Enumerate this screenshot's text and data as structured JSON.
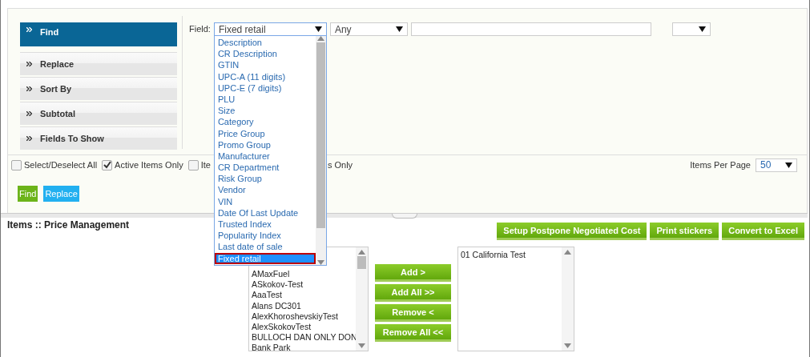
{
  "menu": [
    {
      "label": "Find",
      "selected": true
    },
    {
      "label": "Replace",
      "selected": false
    },
    {
      "label": "Sort By",
      "selected": false
    },
    {
      "label": "Subtotal",
      "selected": false
    },
    {
      "label": "Fields To Show",
      "selected": false
    }
  ],
  "filter": {
    "label": "Field:",
    "field_value": "Fixed retail",
    "operator_value": "Any",
    "field_options": [
      {
        "label": "Description",
        "selected": false
      },
      {
        "label": "CR Description",
        "selected": false
      },
      {
        "label": "GTIN",
        "selected": false
      },
      {
        "label": "UPC-A (11 digits)",
        "selected": false
      },
      {
        "label": "UPC-E (7 digits)",
        "selected": false
      },
      {
        "label": "PLU",
        "selected": false
      },
      {
        "label": "Size",
        "selected": false
      },
      {
        "label": "Category",
        "selected": false
      },
      {
        "label": "Price Group",
        "selected": false
      },
      {
        "label": "Promo Group",
        "selected": false
      },
      {
        "label": "Manufacturer",
        "selected": false
      },
      {
        "label": "CR Department",
        "selected": false
      },
      {
        "label": "Risk Group",
        "selected": false
      },
      {
        "label": "Vendor",
        "selected": false
      },
      {
        "label": "VIN",
        "selected": false
      },
      {
        "label": "Date Of Last Update",
        "selected": false
      },
      {
        "label": "Trusted Index",
        "selected": false
      },
      {
        "label": "Popularity Index",
        "selected": false
      },
      {
        "label": "Last date of sale",
        "selected": false
      },
      {
        "label": "Fixed retail",
        "selected": true
      }
    ]
  },
  "options": [
    {
      "label": "Select/Deselect All",
      "checked": false
    },
    {
      "label": "Active Items Only",
      "checked": true
    },
    {
      "label": "Ite",
      "checked": false
    }
  ],
  "options_tail": "s Only",
  "items_per_page": {
    "label": "Items Per Page",
    "value": "50"
  },
  "actions": [
    "Find",
    "Replace"
  ],
  "section_title": "Items :: Price Management",
  "toolbar": [
    "Setup Postpone Negotiated Cost",
    "Print stickers",
    "Convert to Excel"
  ],
  "available": [
    "AMaxFuel",
    "ASkokov-Test",
    "AaaTest",
    "Alans DC301",
    "AlexKhoroshevskiyTest",
    "AlexSkokovTest",
    "BULLOCH DAN ONLY DON",
    "Bank Park"
  ],
  "transfer_buttons": [
    "Add >",
    "Add All >>",
    "Remove <",
    "Remove All <<"
  ],
  "chosen": [
    "01 California Test"
  ]
}
